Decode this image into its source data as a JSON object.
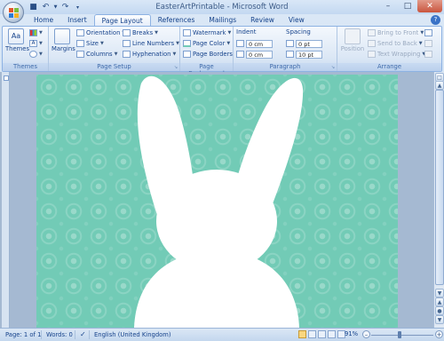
{
  "window": {
    "title": "EasterArtPrintable - Microsoft Word"
  },
  "tabs": [
    "Home",
    "Insert",
    "Page Layout",
    "References",
    "Mailings",
    "Review",
    "View"
  ],
  "active_tab": "Page Layout",
  "ribbon": {
    "themes": {
      "button": "Themes",
      "group": "Themes"
    },
    "page_setup": {
      "margins": "Margins",
      "orientation": "Orientation",
      "size": "Size",
      "columns": "Columns",
      "breaks": "Breaks",
      "line_numbers": "Line Numbers",
      "hyphenation": "Hyphenation",
      "group": "Page Setup"
    },
    "page_background": {
      "watermark": "Watermark",
      "page_color": "Page Color",
      "page_borders": "Page Borders",
      "group": "Page Background"
    },
    "paragraph": {
      "indent_label": "Indent",
      "spacing_label": "Spacing",
      "indent_left": "0 cm",
      "indent_right": "0 cm",
      "spacing_before": "0 pt",
      "spacing_after": "10 pt",
      "group": "Paragraph"
    },
    "arrange": {
      "position": "Position",
      "bring_to_front": "Bring to Front",
      "send_to_back": "Send to Back",
      "text_wrapping": "Text Wrapping",
      "group": "Arrange"
    }
  },
  "status": {
    "page": "Page: 1 of 1",
    "words": "Words: 0",
    "language": "English (United Kingdom)",
    "zoom": "91%",
    "zoom_level": 0.91
  },
  "colors": {
    "page_background": "#72cbb6",
    "bunny": "#ffffff"
  }
}
